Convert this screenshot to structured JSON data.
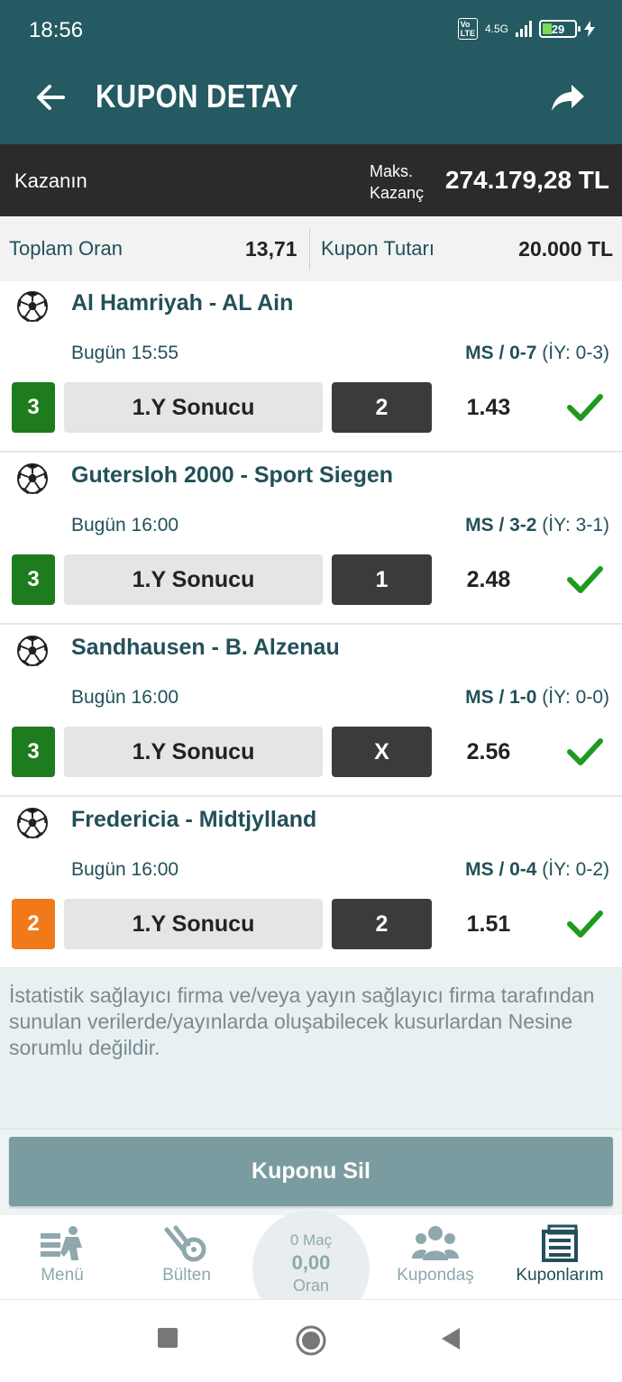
{
  "status": {
    "time": "18:56",
    "network": "4.5G",
    "volte": "Vo LTE",
    "battery": "29"
  },
  "appbar": {
    "title": "KUPON DETAY",
    "back_icon": "arrow-left-icon",
    "share_icon": "share-icon"
  },
  "win": {
    "label": "Kazanın",
    "max_line1": "Maks.",
    "max_line2": "Kazanç",
    "amount": "274.179,28 TL"
  },
  "summary": {
    "total_odds_label": "Toplam Oran",
    "total_odds": "13,71",
    "stake_label": "Kupon Tutarı",
    "stake": "20.000 TL"
  },
  "matches": [
    {
      "name": "Al Hamriyah - AL Ain",
      "date": "Bugün 15:55",
      "score_bold": "MS / 0-7",
      "score_ht": " (İY: 0-3)",
      "mbs": "3",
      "mbs_color": "#1e7b1e",
      "market": "1.Y Sonucu",
      "pick": "2",
      "odd": "1.43"
    },
    {
      "name": "Gutersloh 2000 - Sport Siegen",
      "date": "Bugün 16:00",
      "score_bold": "MS / 3-2",
      "score_ht": " (İY: 3-1)",
      "mbs": "3",
      "mbs_color": "#1e7b1e",
      "market": "1.Y Sonucu",
      "pick": "1",
      "odd": "2.48"
    },
    {
      "name": "Sandhausen - B. Alzenau",
      "date": "Bugün 16:00",
      "score_bold": "MS / 1-0",
      "score_ht": " (İY: 0-0)",
      "mbs": "3",
      "mbs_color": "#1e7b1e",
      "market": "1.Y Sonucu",
      "pick": "X",
      "odd": "2.56"
    },
    {
      "name": "Fredericia - Midtjylland",
      "date": "Bugün 16:00",
      "score_bold": "MS / 0-4",
      "score_ht": " (İY: 0-2)",
      "mbs": "2",
      "mbs_color": "#f07a1a",
      "market": "1.Y Sonucu",
      "pick": "2",
      "odd": "1.51"
    }
  ],
  "disclaimer": "İstatistik sağlayıcı firma ve/veya yayın sağlayıcı firma tarafından sunulan verilerde/yayınlarda oluşabilecek kusurlardan Nesine sorumlu değildir.",
  "delete_button": "Kuponu Sil",
  "tabs": {
    "menu": "Menü",
    "bulletin": "Bülten",
    "center_matches": "0 Maç",
    "center_value": "0,00",
    "center_odds": "Oran",
    "kupondas": "Kupondaş",
    "kuponlarim": "Kuponlarım"
  },
  "colors": {
    "header": "#255a62",
    "winbar": "#2b2b2b",
    "success": "#1e9a1e",
    "accent_text": "#22505a"
  }
}
